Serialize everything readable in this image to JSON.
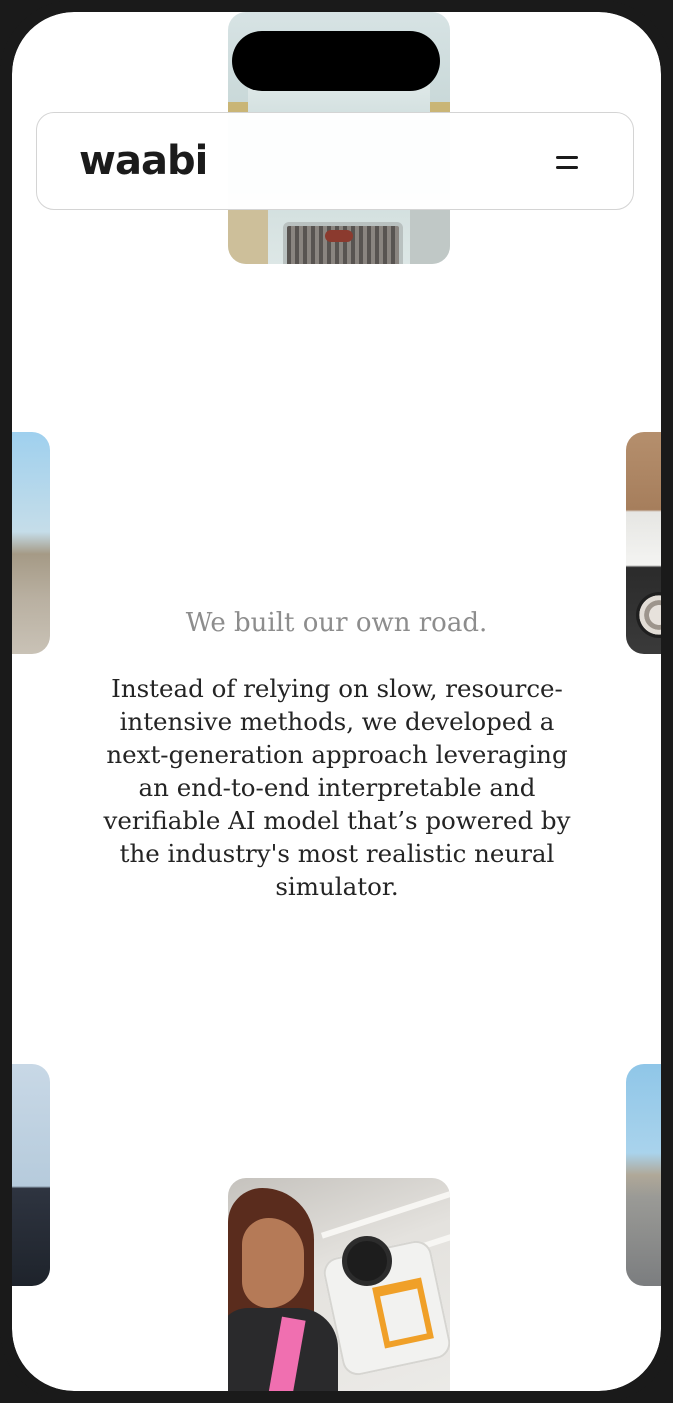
{
  "header": {
    "logo_text": "waabi",
    "menu_icon": "hamburger-menu-icon"
  },
  "hero": {
    "subtitle": "We built our own road.",
    "body": "Instead of relying on slow, resource-intensive methods, we developed a next-generation approach leveraging an end-to-end interpretable and verifiable AI model that’s powered by the industry's most realistic neural simulator."
  },
  "images": [
    {
      "name": "truck-front-photo"
    },
    {
      "name": "desert-road-photo"
    },
    {
      "name": "truck-wheel-photo"
    },
    {
      "name": "person-photo"
    },
    {
      "name": "highway-photo"
    },
    {
      "name": "engineer-sensor-photo"
    }
  ],
  "colors": {
    "frame": "#1a1a1a",
    "background": "#ffffff",
    "subtitle": "#8d8d8d",
    "body": "#242424"
  }
}
